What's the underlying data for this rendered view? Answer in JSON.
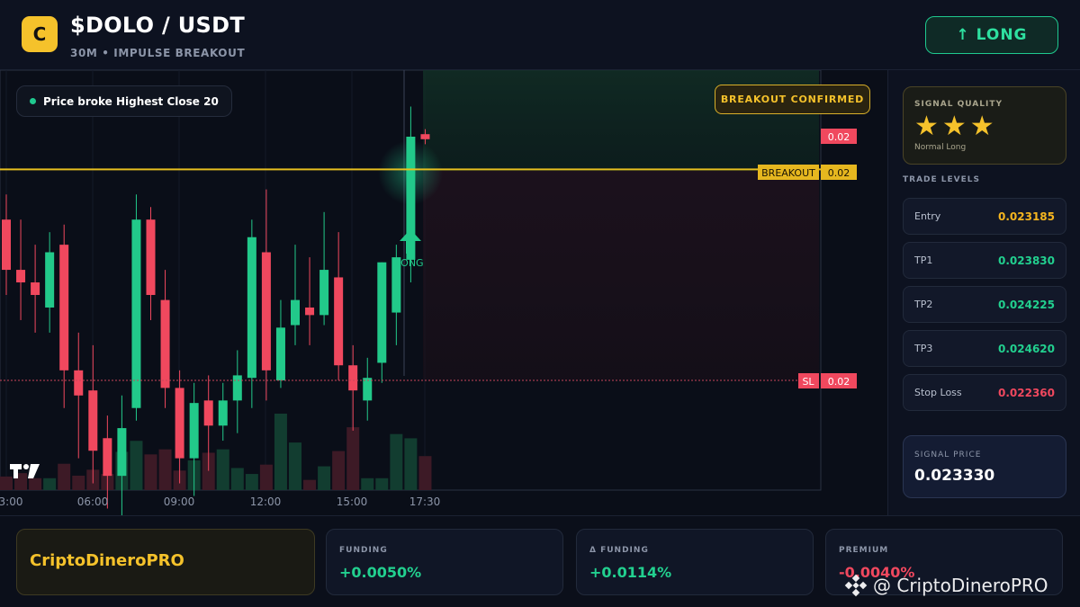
{
  "header": {
    "logo_letter": "C",
    "pair": "$DOLO / USDT",
    "subtitle": "30M • IMPULSE BREAKOUT",
    "signal_button": "↑ LONG"
  },
  "chart": {
    "message": "Price broke Highest Close 20",
    "confirm_badge": "BREAKOUT CONFIRMED",
    "signal_marker": "LONG",
    "price_tags": {
      "last_price": "0.02",
      "breakout_label": "BREAKOUT",
      "breakout_price": "0.02",
      "sl_label": "SL",
      "sl_price": "0.02"
    },
    "time_labels": [
      "3:00",
      "06:00",
      "09:00",
      "12:00",
      "15:00",
      "17:30"
    ]
  },
  "chart_data": {
    "type": "candlestick",
    "interval": "30m",
    "up_color": "#22c98a",
    "down_color": "#f0485e",
    "breakout_level": 0.0232,
    "stop_loss": 0.02236,
    "candles": [
      {
        "o": 0.023,
        "h": 0.0231,
        "c": 0.0228,
        "l": 0.0227
      },
      {
        "o": 0.0228,
        "h": 0.023,
        "c": 0.02275,
        "l": 0.0226
      },
      {
        "o": 0.02275,
        "h": 0.0229,
        "c": 0.0227,
        "l": 0.02255
      },
      {
        "o": 0.02265,
        "h": 0.02295,
        "c": 0.02287,
        "l": 0.02255
      },
      {
        "o": 0.0229,
        "h": 0.02298,
        "c": 0.0224,
        "l": 0.02225
      },
      {
        "o": 0.0224,
        "h": 0.02255,
        "c": 0.0223,
        "l": 0.02205
      },
      {
        "o": 0.02232,
        "h": 0.0225,
        "c": 0.02208,
        "l": 0.02195
      },
      {
        "o": 0.02213,
        "h": 0.02222,
        "c": 0.02198,
        "l": 0.02185
      },
      {
        "o": 0.02198,
        "h": 0.0223,
        "c": 0.02217,
        "l": 0.0218
      },
      {
        "o": 0.02225,
        "h": 0.0231,
        "c": 0.023,
        "l": 0.0222
      },
      {
        "o": 0.023,
        "h": 0.02305,
        "c": 0.0227,
        "l": 0.0226
      },
      {
        "o": 0.02268,
        "h": 0.0228,
        "c": 0.02233,
        "l": 0.02225
      },
      {
        "o": 0.02233,
        "h": 0.0224,
        "c": 0.02205,
        "l": 0.02195
      },
      {
        "o": 0.02205,
        "h": 0.02235,
        "c": 0.02227,
        "l": 0.0219
      },
      {
        "o": 0.02228,
        "h": 0.02238,
        "c": 0.02218,
        "l": 0.022
      },
      {
        "o": 0.02218,
        "h": 0.02235,
        "c": 0.02228,
        "l": 0.02212
      },
      {
        "o": 0.02228,
        "h": 0.02248,
        "c": 0.02238,
        "l": 0.02215
      },
      {
        "o": 0.02237,
        "h": 0.023,
        "c": 0.02293,
        "l": 0.02225
      },
      {
        "o": 0.02287,
        "h": 0.02312,
        "c": 0.0224,
        "l": 0.02228
      },
      {
        "o": 0.02236,
        "h": 0.02268,
        "c": 0.02257,
        "l": 0.02233
      },
      {
        "o": 0.02258,
        "h": 0.0229,
        "c": 0.02268,
        "l": 0.0225
      },
      {
        "o": 0.02265,
        "h": 0.02285,
        "c": 0.02262,
        "l": 0.0225
      },
      {
        "o": 0.02262,
        "h": 0.02303,
        "c": 0.0228,
        "l": 0.02258
      },
      {
        "o": 0.02277,
        "h": 0.02295,
        "c": 0.02242,
        "l": 0.02236
      },
      {
        "o": 0.02242,
        "h": 0.0225,
        "c": 0.02232,
        "l": 0.02216
      },
      {
        "o": 0.02228,
        "h": 0.02245,
        "c": 0.02237,
        "l": 0.0222
      },
      {
        "o": 0.02243,
        "h": 0.02283,
        "c": 0.02283,
        "l": 0.02235
      },
      {
        "o": 0.02263,
        "h": 0.0229,
        "c": 0.02285,
        "l": 0.0225
      },
      {
        "o": 0.02284,
        "h": 0.02345,
        "c": 0.02333,
        "l": 0.02275
      },
      {
        "o": 0.02334,
        "h": 0.02336,
        "c": 0.02332,
        "l": 0.0233
      }
    ],
    "volume": [
      16,
      20,
      14,
      14,
      31,
      17,
      24,
      19,
      45,
      58,
      42,
      48,
      23,
      35,
      44,
      48,
      26,
      19,
      30,
      90,
      56,
      12,
      28,
      46,
      74,
      14,
      14,
      66,
      61,
      40
    ]
  },
  "side": {
    "quality_label": "SIGNAL QUALITY",
    "stars": "★★★",
    "quality_sub": "Normal Long",
    "levels_title": "TRADE LEVELS",
    "levels": [
      {
        "label": "Entry",
        "value": "0.023185",
        "color": "#f5b51f"
      },
      {
        "label": "TP1",
        "value": "0.023830",
        "color": "#22d08f"
      },
      {
        "label": "TP2",
        "value": "0.024225",
        "color": "#22d08f"
      },
      {
        "label": "TP3",
        "value": "0.024620",
        "color": "#22d08f"
      },
      {
        "label": "Stop Loss",
        "value": "0.022360",
        "color": "#f0485e"
      }
    ],
    "signal_price_label": "SIGNAL PRICE",
    "signal_price": "0.023330"
  },
  "bottom": {
    "brand": "CriptoDineroPRO",
    "metrics": [
      {
        "label": "FUNDING",
        "value": "+0.0050%",
        "color": "#22d08f"
      },
      {
        "label": "Δ FUNDING",
        "value": "+0.0114%",
        "color": "#22d08f"
      },
      {
        "label": "PREMIUM",
        "value": "-0.0040%",
        "color": "#f0485e"
      }
    ],
    "watermark": "@ CriptoDineroPRO"
  }
}
